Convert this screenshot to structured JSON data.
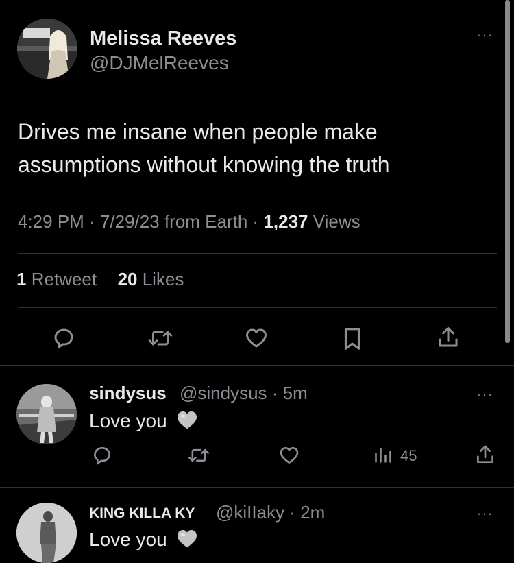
{
  "main_tweet": {
    "author_name": "Melissa Reeves",
    "author_handle": "@DJMelReeves",
    "text_line1": "Drives me insane when people make",
    "text_line2": "assumptions without knowing the truth",
    "time": "4:29 PM",
    "date": "7/29/23",
    "source": "from Earth",
    "views_count": "1,237",
    "views_label": "Views",
    "retweets_count": "1",
    "retweets_label": "Retweet",
    "likes_count": "20",
    "likes_label": "Likes",
    "more": "···"
  },
  "replies": [
    {
      "author_name": "sindysus",
      "author_handle": "@sindysus",
      "time": "5m",
      "text": "Love you",
      "views": "45",
      "more": "···"
    },
    {
      "author_name": "KING KILLA KY",
      "author_handle": "@kiIIaky",
      "time": "2m",
      "text": "Love you",
      "more": "···"
    }
  ],
  "icons": {
    "reply": "reply-bubble-icon",
    "retweet": "retweet-arrows-icon",
    "like": "heart-outline-icon",
    "bookmark": "bookmark-icon",
    "share": "share-upload-icon",
    "views": "bar-chart-icon",
    "emoji": "grey-heart-emoji"
  }
}
